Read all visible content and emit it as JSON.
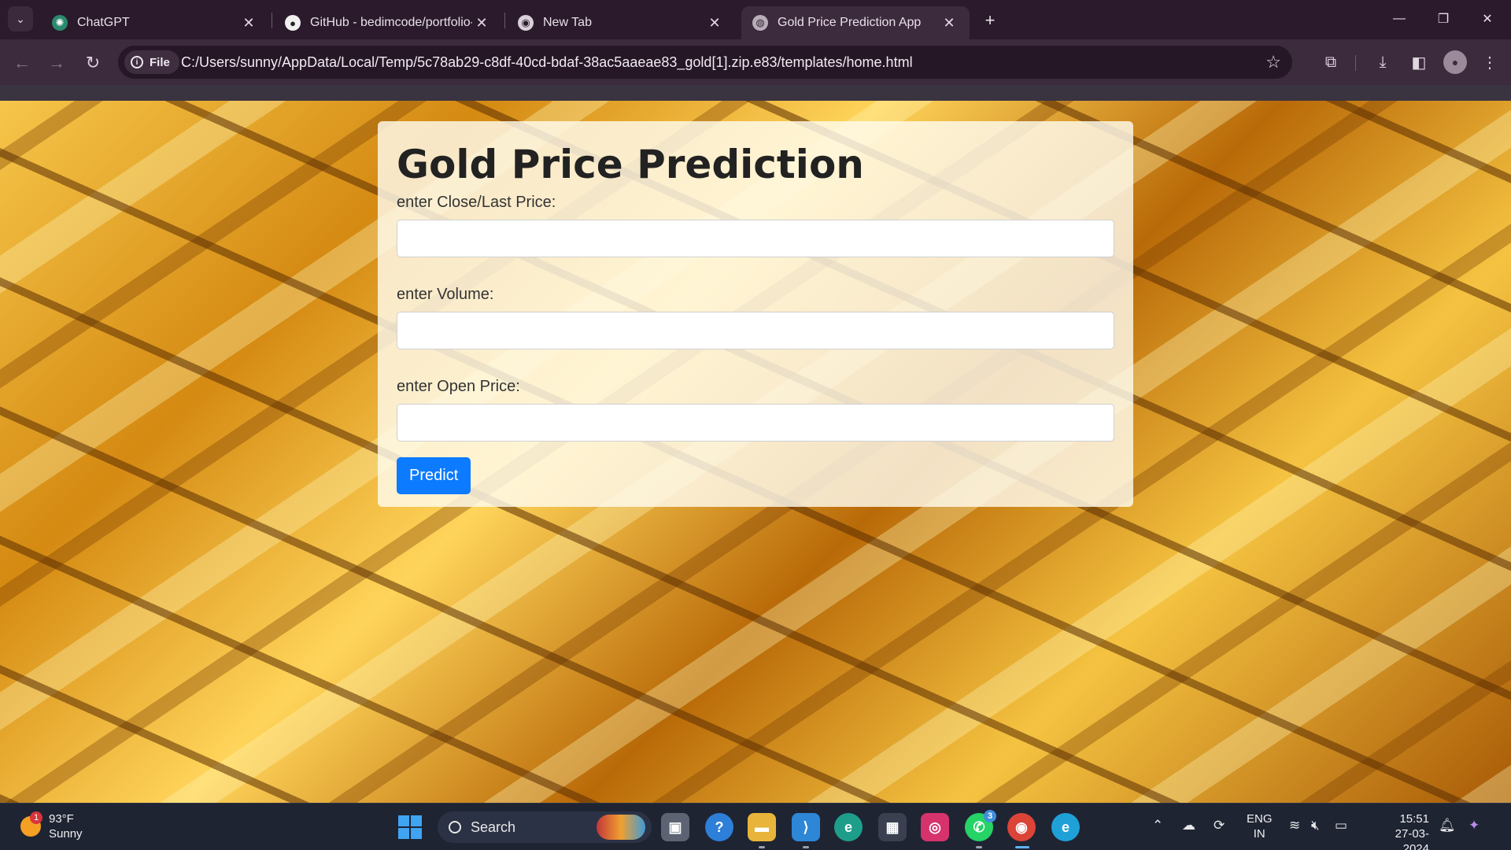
{
  "browser": {
    "tabs": [
      {
        "title": "ChatGPT",
        "icon": "chatgpt-icon",
        "active": false
      },
      {
        "title": "GitHub - bedimcode/portfolio-",
        "icon": "github-icon",
        "active": false
      },
      {
        "title": "New Tab",
        "icon": "chrome-icon",
        "active": false
      },
      {
        "title": "Gold Price Prediction App",
        "icon": "globe-icon",
        "active": true
      }
    ],
    "address": {
      "chip_label": "File",
      "url": "C:/Users/sunny/AppData/Local/Temp/5c78ab29-c8df-40cd-bdaf-38ac5aaeae83_gold[1].zip.e83/templates/home.html"
    }
  },
  "page": {
    "heading": "Gold Price Prediction",
    "fields": [
      {
        "label": "enter Close/Last Price:",
        "value": ""
      },
      {
        "label": "enter Volume:",
        "value": ""
      },
      {
        "label": "enter Open Price:",
        "value": ""
      }
    ],
    "submit_label": "Predict",
    "colors": {
      "button": "#0d7bff",
      "card": "#fffbee"
    }
  },
  "taskbar": {
    "weather": {
      "temp": "93°F",
      "condition": "Sunny",
      "badge": "1"
    },
    "search_placeholder": "Search",
    "whatsapp_badge": "3",
    "language": {
      "line1": "ENG",
      "line2": "IN"
    },
    "clock": {
      "time": "15:51",
      "date": "27-03-2024"
    }
  }
}
